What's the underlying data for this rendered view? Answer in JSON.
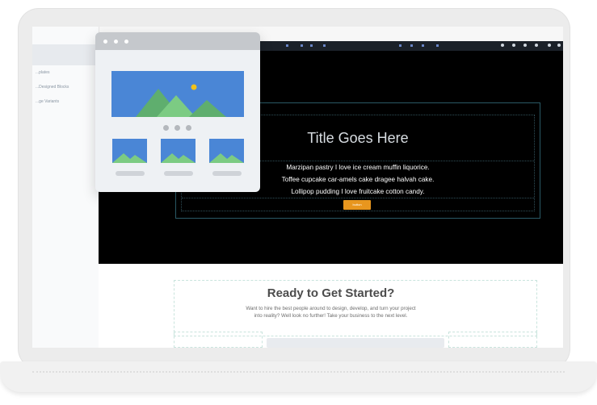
{
  "hero": {
    "title": "Title Goes Here",
    "lines": [
      "Marzipan pastry I love ice cream muffin liquorice.",
      "Toffee cupcake car-amels cake dragee halvah cake.",
      "Lollipop pudding I love fruitcake cotton candy."
    ],
    "button_label": "button"
  },
  "cta": {
    "title": "Ready to Get Started?",
    "lines": [
      "Want to hire the best people around to design, develop, and turn your project",
      "into reality? Well look no further! Take your business to the next level."
    ]
  },
  "sidebar": {
    "items": [
      "...plates",
      "...Designed Blocks",
      "...ge Variants"
    ]
  },
  "colors": {
    "accent": "#e8961e",
    "hero_bg": "#000000",
    "illustration_blue": "#4a86d6",
    "illustration_green": "#7ccb83",
    "sun": "#f2c21b"
  }
}
